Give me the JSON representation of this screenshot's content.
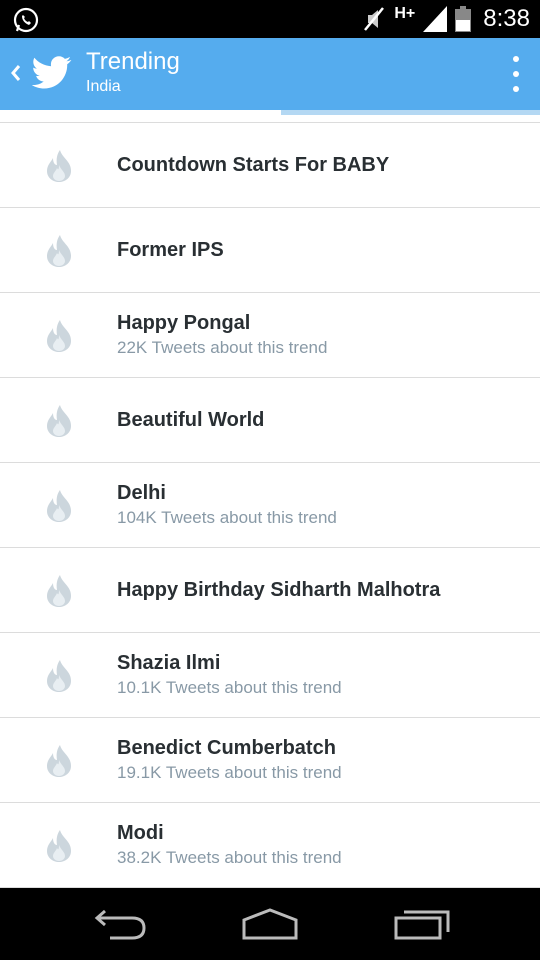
{
  "status_bar": {
    "time": "8:38",
    "network": "H+",
    "icons": [
      "whatsapp-icon",
      "mute-icon",
      "signal-icon",
      "battery-icon"
    ]
  },
  "header": {
    "title": "Trending",
    "subtitle": "India",
    "color": "#55acee"
  },
  "trends": [
    {
      "name": "Countdown Starts For BABY",
      "count": ""
    },
    {
      "name": "Former IPS",
      "count": ""
    },
    {
      "name": "Happy Pongal",
      "count": "22K Tweets about this trend"
    },
    {
      "name": "Beautiful World",
      "count": ""
    },
    {
      "name": "Delhi",
      "count": "104K Tweets about this trend"
    },
    {
      "name": "Happy Birthday Sidharth Malhotra",
      "count": ""
    },
    {
      "name": "Shazia Ilmi",
      "count": "10.1K Tweets about this trend"
    },
    {
      "name": "Benedict Cumberbatch",
      "count": "19.1K Tweets about this trend"
    },
    {
      "name": "Modi",
      "count": "38.2K Tweets about this trend"
    }
  ],
  "navigation": [
    "back-icon",
    "home-icon",
    "recents-icon"
  ]
}
